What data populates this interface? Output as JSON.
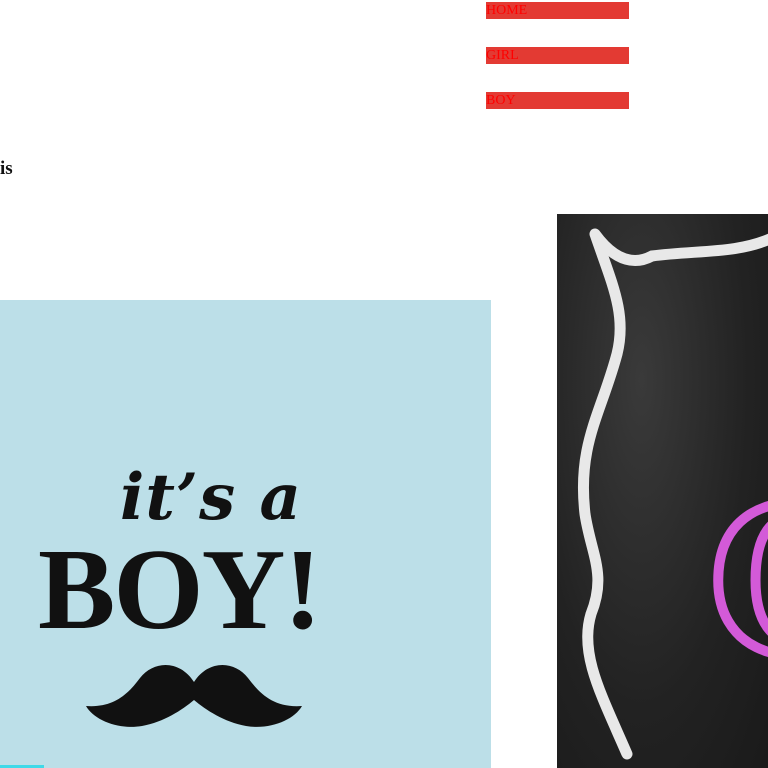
{
  "nav": {
    "items": [
      {
        "label": "HOME"
      },
      {
        "label": "GIRL"
      },
      {
        "label": "BOY"
      }
    ]
  },
  "intro": {
    "text": "is"
  },
  "boy_card": {
    "line1": "it’s a",
    "line2": "BOY!",
    "background": "#bcdfe8"
  },
  "chalk_card": {
    "letter": "G",
    "letter_color": "#d35ad8"
  },
  "colors": {
    "nav_bg": "#e33a33",
    "nav_text": "#ff0000"
  }
}
